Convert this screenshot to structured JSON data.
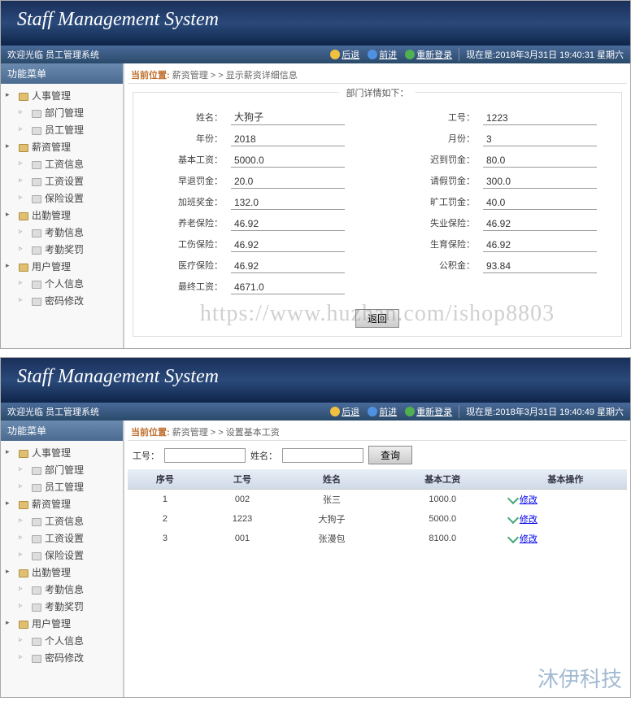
{
  "app_title": "Staff Management System",
  "welcome": "欢迎光临 员工管理系统",
  "nav": {
    "back": "后退",
    "forward": "前进",
    "relogin": "重新登录"
  },
  "status1": "现在是:2018年3月31日 19:40:31 星期六",
  "status2": "现在是:2018年3月31日 19:40:49 星期六",
  "side_title": "功能菜单",
  "sidebar": [
    {
      "label": "人事管理",
      "children": [
        "部门管理",
        "员工管理"
      ]
    },
    {
      "label": "薪资管理",
      "children": [
        "工资信息",
        "工资设置",
        "保险设置"
      ]
    },
    {
      "label": "出勤管理",
      "children": [
        "考勤信息",
        "考勤奖罚"
      ]
    },
    {
      "label": "用户管理",
      "children": [
        "个人信息",
        "密码修改"
      ]
    }
  ],
  "bc_label": "当前位置:",
  "bc1": "薪资管理 > > 显示薪资详细信息",
  "bc2": "薪资管理 > > 设置基本工资",
  "fieldset_legend": "部门详情如下：",
  "detail": {
    "name_l": "姓名：",
    "name": "大狗子",
    "empno_l": "工号：",
    "empno": "1223",
    "year_l": "年份：",
    "year": "2018",
    "month_l": "月份：",
    "month": "3",
    "base_l": "基本工资：",
    "base": "5000.0",
    "late_l": "迟到罚金：",
    "late": "80.0",
    "early_l": "早退罚金：",
    "early": "20.0",
    "leave_l": "请假罚金：",
    "leave": "300.0",
    "ot_l": "加班奖金：",
    "ot": "132.0",
    "absent_l": "旷工罚金：",
    "absent": "40.0",
    "pension_l": "养老保险：",
    "pension": "46.92",
    "unemp_l": "失业保险：",
    "unemp": "46.92",
    "injury_l": "工伤保险：",
    "injury": "46.92",
    "birth_l": "生育保险：",
    "birth": "46.92",
    "medical_l": "医疗保险：",
    "medical": "46.92",
    "fund_l": "公积金：",
    "fund": "93.84",
    "final_l": "最终工资：",
    "final": "4671.0"
  },
  "back_btn": "返回",
  "watermark": "https://www.huzhan.com/ishop8803",
  "watermark2": "沐伊科技",
  "search": {
    "empno_l": "工号：",
    "name_l": "姓名：",
    "btn": "查询"
  },
  "table": {
    "headers": [
      "序号",
      "工号",
      "姓名",
      "基本工资",
      "基本操作"
    ],
    "rows": [
      {
        "idx": "1",
        "no": "002",
        "name": "张三",
        "salary": "1000.0",
        "op": "修改"
      },
      {
        "idx": "2",
        "no": "1223",
        "name": "大狗子",
        "salary": "5000.0",
        "op": "修改"
      },
      {
        "idx": "3",
        "no": "001",
        "name": "张漫包",
        "salary": "8100.0",
        "op": "修改"
      }
    ]
  }
}
